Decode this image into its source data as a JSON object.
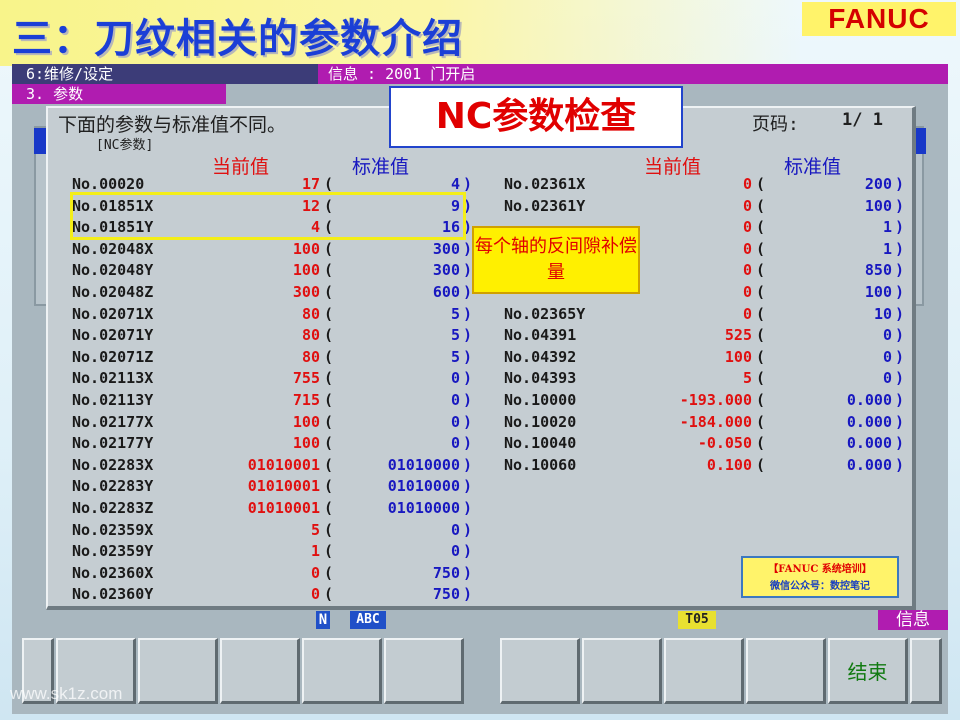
{
  "slide": {
    "title": "三：刀纹相关的参数介绍",
    "logo": "FANUC",
    "watermark": "www.sk1z.com"
  },
  "cnc": {
    "mode_label": "6:维修/设定",
    "message": "信息 : 2001 门开启",
    "screen_label": "3. 参数",
    "dialog": {
      "heading": "下面的参数与标准值不同。",
      "subheading": "[NC参数]",
      "page_label": "页码:",
      "page_value": "1/ 1",
      "col_current": "当前值",
      "col_standard": "标准值",
      "left_rows": [
        {
          "param": "No.00020",
          "current": "17",
          "standard": "4"
        },
        {
          "param": "No.01851X",
          "current": "12",
          "standard": "9"
        },
        {
          "param": "No.01851Y",
          "current": "4",
          "standard": "16"
        },
        {
          "param": "No.02048X",
          "current": "100",
          "standard": "300"
        },
        {
          "param": "No.02048Y",
          "current": "100",
          "standard": "300"
        },
        {
          "param": "No.02048Z",
          "current": "300",
          "standard": "600"
        },
        {
          "param": "No.02071X",
          "current": "80",
          "standard": "5"
        },
        {
          "param": "No.02071Y",
          "current": "80",
          "standard": "5"
        },
        {
          "param": "No.02071Z",
          "current": "80",
          "standard": "5"
        },
        {
          "param": "No.02113X",
          "current": "755",
          "standard": "0"
        },
        {
          "param": "No.02113Y",
          "current": "715",
          "standard": "0"
        },
        {
          "param": "No.02177X",
          "current": "100",
          "standard": "0"
        },
        {
          "param": "No.02177Y",
          "current": "100",
          "standard": "0"
        },
        {
          "param": "No.02283X",
          "current": "01010001",
          "standard": "01010000"
        },
        {
          "param": "No.02283Y",
          "current": "01010001",
          "standard": "01010000"
        },
        {
          "param": "No.02283Z",
          "current": "01010001",
          "standard": "01010000"
        },
        {
          "param": "No.02359X",
          "current": "5",
          "standard": "0"
        },
        {
          "param": "No.02359Y",
          "current": "1",
          "standard": "0"
        },
        {
          "param": "No.02360X",
          "current": "0",
          "standard": "750"
        },
        {
          "param": "No.02360Y",
          "current": "0",
          "standard": "750"
        }
      ],
      "right_rows": [
        {
          "param": "No.02361X",
          "current": "0",
          "standard": "200"
        },
        {
          "param": "No.02361Y",
          "current": "0",
          "standard": "100"
        },
        {
          "param": "",
          "current": "0",
          "standard": "1"
        },
        {
          "param": "",
          "current": "0",
          "standard": "1"
        },
        {
          "param": "",
          "current": "0",
          "standard": "850"
        },
        {
          "param": "",
          "current": "0",
          "standard": "100"
        },
        {
          "param": "No.02365Y",
          "current": "0",
          "standard": "10"
        },
        {
          "param": "No.04391",
          "current": "525",
          "standard": "0"
        },
        {
          "param": "No.04392",
          "current": "100",
          "standard": "0"
        },
        {
          "param": "No.04393",
          "current": "5",
          "standard": "0"
        },
        {
          "param": "No.10000",
          "current": "-193.000",
          "standard": "0.000"
        },
        {
          "param": "No.10020",
          "current": "-184.000",
          "standard": "0.000"
        },
        {
          "param": "No.10040",
          "current": "-0.050",
          "standard": "0.000"
        },
        {
          "param": "No.10060",
          "current": "0.100",
          "standard": "0.000"
        }
      ]
    },
    "status": {
      "n": "N",
      "abc": "ABC",
      "tool": "T05",
      "info": "信息"
    },
    "softkeys": [
      "",
      "",
      "",
      "",
      "",
      "",
      "",
      "",
      "",
      "",
      "结束",
      ""
    ]
  },
  "overlays": {
    "nc_title": "NC参数检查",
    "callout": "每个轴的反间隙补偿量",
    "wechat_line1": "【FANUC 系统培训】",
    "wechat_line2": "微信公众号：数控笔记"
  }
}
